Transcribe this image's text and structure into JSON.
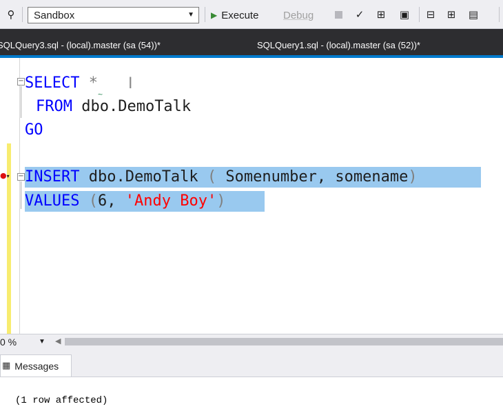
{
  "toolbar": {
    "database": "Sandbox",
    "execute_label": "Execute",
    "debug_label": "Debug"
  },
  "tabs": [
    {
      "label": "SQLQuery3.sql - (local).master (sa (54))*"
    },
    {
      "label": "SQLQuery1.sql - (local).master (sa (52))*"
    }
  ],
  "editor": {
    "lines": [
      {
        "kw": "SELECT",
        "rest": " *"
      },
      {
        "kw": "FROM",
        "rest": " dbo.DemoTalk"
      },
      {
        "kw": "GO",
        "rest": ""
      },
      {
        "kw": "INSERT",
        "obj": " dbo.DemoTalk ",
        "open": "(",
        "cols": " Somenumber, somename",
        "close": ")"
      },
      {
        "kw": "VALUES",
        "open": " (",
        "num": "6, ",
        "str": "'Andy Boy'",
        "close": ")"
      }
    ]
  },
  "zoom": {
    "value": "0 %"
  },
  "results": {
    "tab_label": "Messages",
    "message": "(1 row affected)"
  }
}
